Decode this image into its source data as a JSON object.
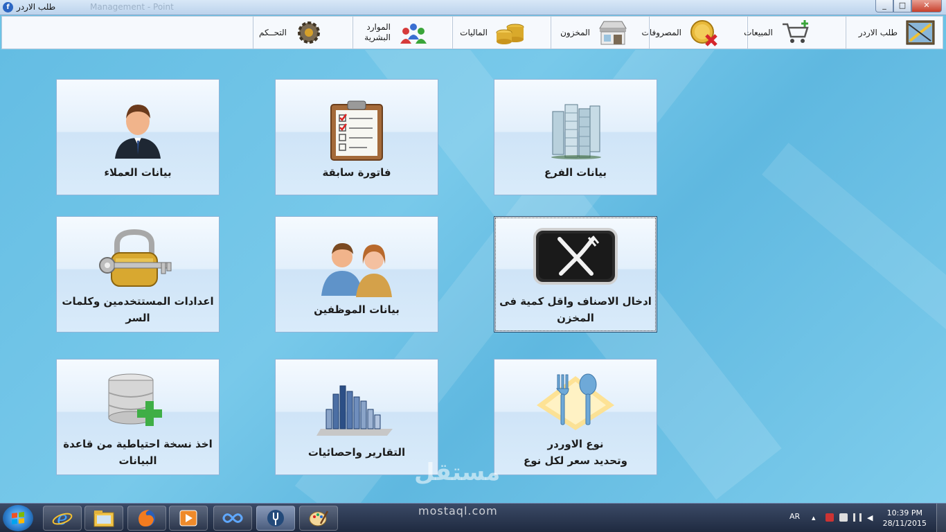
{
  "window": {
    "title": "طلب الاردر",
    "ghost_title": "Management - Point",
    "buttons": {
      "minimize": "_",
      "maximize": "□",
      "close": "✕"
    }
  },
  "menubar": {
    "items": [
      {
        "label": "طلب الاردر",
        "icon": "order-pencil-icon"
      },
      {
        "label": "المبيعات",
        "icon": "shopping-cart-icon"
      },
      {
        "label": "المصروفات",
        "icon": "expense-coin-icon"
      },
      {
        "label": "المخزون",
        "icon": "store-icon"
      },
      {
        "label": "الماليات",
        "icon": "coins-icon"
      },
      {
        "label_line1": "الموارد",
        "label_line2": "البشرية",
        "icon": "people-icon"
      },
      {
        "label": "التحــكم",
        "icon": "gear-icon"
      }
    ]
  },
  "tiles": {
    "customers": {
      "label": "بيانات العملاء",
      "icon": "customer-icon"
    },
    "previous_invoice": {
      "label": "فاتورة سابقة",
      "icon": "clipboard-icon"
    },
    "branch": {
      "label": "بيانات الفرع",
      "icon": "buildings-icon"
    },
    "user_settings": {
      "label": "اعدادات المستتخدمين وكلمات السر",
      "icon": "lock-key-icon"
    },
    "employees": {
      "label": "بيانات الموظفين",
      "icon": "employees-icon"
    },
    "items_entry": {
      "label": "ادخال الاصناف واقل كمية فى المخزن",
      "icon": "fork-knife-icon"
    },
    "backup": {
      "label": "اخذ نسخة احتياطية من قاعدة البيانات",
      "icon": "database-add-icon"
    },
    "reports": {
      "label": "التقارير واحصائيات",
      "icon": "bar-chart-icon"
    },
    "order_type": {
      "label_line1": "نوع الاوردر",
      "label_line2": "وتحديد سعر لكل نوع",
      "icon": "fork-spoon-icon"
    }
  },
  "watermark": {
    "arabic": "مستقل",
    "latin": "mostaql.com"
  },
  "taskbar": {
    "buttons": [
      "internet-explorer-icon",
      "folder-icon",
      "firefox-icon",
      "media-player-icon",
      "infinity-icon",
      "app-fork-icon",
      "paint-icon"
    ],
    "tray": {
      "language": "AR",
      "time": "10:39 PM",
      "date": "28/11/2015"
    }
  }
}
